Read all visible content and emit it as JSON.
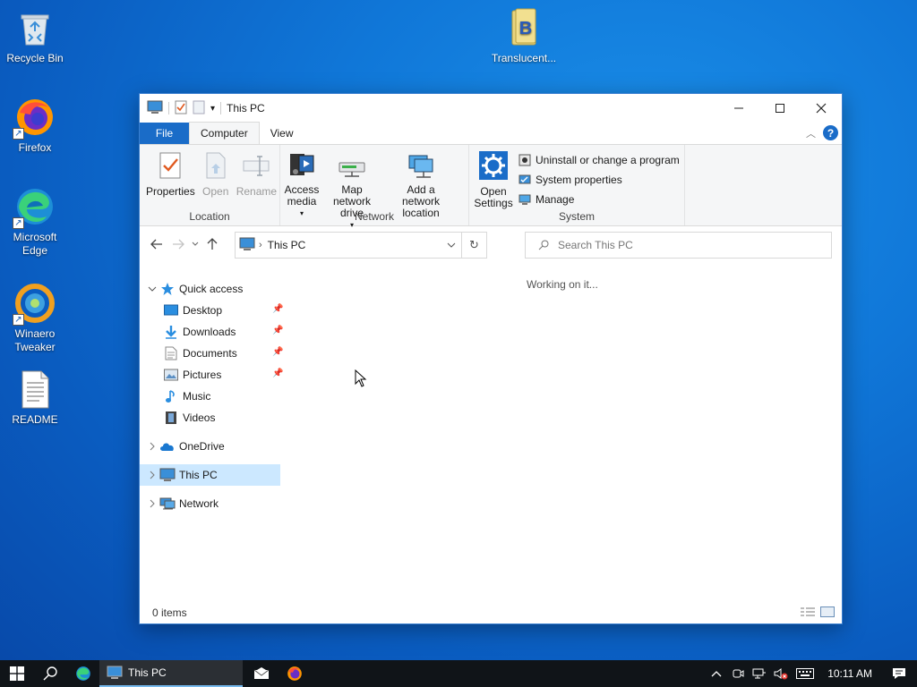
{
  "desktop": {
    "icons": [
      {
        "label": "Recycle Bin",
        "icon": "recycle-bin-icon"
      },
      {
        "label": "Firefox",
        "icon": "firefox-icon"
      },
      {
        "label": "Microsoft Edge",
        "icon": "edge-icon"
      },
      {
        "label": "Winaero Tweaker",
        "icon": "winaero-tweaker-icon"
      },
      {
        "label": "README",
        "icon": "text-document-icon"
      },
      {
        "label": "Translucent...",
        "icon": "translucent-icon"
      }
    ]
  },
  "window": {
    "title": "This PC",
    "ribbon_tabs": {
      "file": "File",
      "computer": "Computer",
      "view": "View"
    },
    "groups": {
      "location": {
        "label": "Location",
        "properties": "Properties",
        "open": "Open",
        "rename": "Rename"
      },
      "network": {
        "label": "Network",
        "access_media": "Access media",
        "map_network_drive": "Map network drive",
        "add_network_location": "Add a network location"
      },
      "system": {
        "label": "System",
        "open_settings": "Open Settings",
        "uninstall": "Uninstall or change a program",
        "system_properties": "System properties",
        "manage": "Manage"
      }
    },
    "address": {
      "path": "This PC"
    },
    "search": {
      "placeholder": "Search This PC"
    },
    "nav": {
      "quick_access": "Quick access",
      "pinned": [
        "Desktop",
        "Downloads",
        "Documents",
        "Pictures"
      ],
      "music": "Music",
      "videos": "Videos",
      "onedrive": "OneDrive",
      "this_pc": "This PC",
      "network": "Network"
    },
    "content_status": "Working on it...",
    "status_bar": "0 items"
  },
  "taskbar": {
    "active_app": "This PC",
    "clock": "10:11 AM"
  },
  "colors": {
    "accent": "#1a6cc8",
    "selection": "#cce8ff",
    "taskbar": "#101418"
  }
}
